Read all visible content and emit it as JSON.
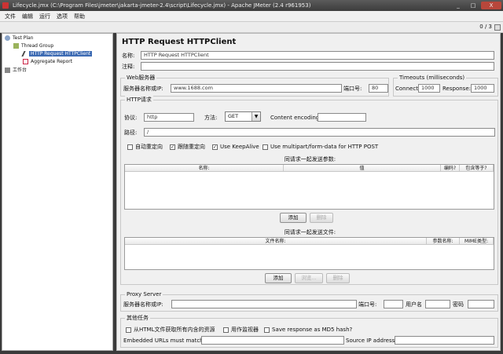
{
  "window": {
    "title": "Lifecycle.jmx (C:\\Program Files\\jmeter\\jakarta-jmeter-2.4\\script\\Lifecycle.jmx) - Apache JMeter (2.4 r961953)",
    "minimize": "_",
    "maximize": "□",
    "close": "X"
  },
  "menu": [
    "文件",
    "编辑",
    "运行",
    "选项",
    "帮助"
  ],
  "toolbar": {
    "counter": "0 / 3"
  },
  "tree": {
    "items": [
      {
        "label": "Test Plan",
        "icon": "test-plan-icon"
      },
      {
        "label": "Thread Group",
        "icon": "thread-group-icon"
      },
      {
        "label": "HTTP Request HTTPClient",
        "icon": "http-sampler-icon"
      },
      {
        "label": "Aggregate Report",
        "icon": "report-icon"
      },
      {
        "label": "工作台",
        "icon": "workbench-icon"
      }
    ]
  },
  "panel": {
    "heading": "HTTP Request HTTPClient",
    "name_label": "名称:",
    "name_value": "HTTP Request HTTPClient",
    "comment_label": "注释:",
    "comment_value": "",
    "web_server": {
      "title": "Web服务器",
      "server_label": "服务器名称或IP:",
      "server_value": "www.1688.com",
      "port_label": "端口号:",
      "port_value": "80"
    },
    "timeouts": {
      "title": "Timeouts (milliseconds)",
      "connect_label": "Connect:",
      "connect_value": "1000",
      "response_label": "Response:",
      "response_value": "1000"
    },
    "http_request": {
      "title": "HTTP请求",
      "protocol_label": "协议:",
      "protocol_value": "http",
      "method_label": "方法:",
      "method_value": "GET",
      "encoding_label": "Content encoding:",
      "encoding_value": "",
      "path_label": "路径:",
      "path_value": "/",
      "checkboxes": [
        {
          "label": "自动重定向",
          "checked": false
        },
        {
          "label": "跟随重定向",
          "checked": true
        },
        {
          "label": "Use KeepAlive",
          "checked": true
        },
        {
          "label": "Use multipart/form-data for HTTP POST",
          "checked": false
        }
      ]
    },
    "params": {
      "title": "同请求一起发送参数:",
      "columns": [
        "名称:",
        "值",
        "编码?",
        "包含等于?"
      ],
      "add": "添加",
      "delete": "删除"
    },
    "files": {
      "title": "同请求一起发送文件:",
      "columns": [
        "文件名称:",
        "参数名称:",
        "MIME类型:"
      ],
      "add": "添加",
      "browse": "浏览...",
      "delete": "删除"
    },
    "proxy": {
      "title": "Proxy Server",
      "server_label": "服务器名称或IP:",
      "port_label": "端口号:",
      "user_label": "用户名",
      "password_label": "密码"
    },
    "other": {
      "title": "其他任务",
      "checkboxes": [
        {
          "label": "从HTML文件获取所有内含的资源",
          "checked": false
        },
        {
          "label": "用作监视器",
          "checked": false
        },
        {
          "label": "Save response as MD5 hash?",
          "checked": false
        }
      ],
      "embedded_label": "Embedded URLs must match:",
      "source_ip_label": "Source IP address:"
    }
  }
}
